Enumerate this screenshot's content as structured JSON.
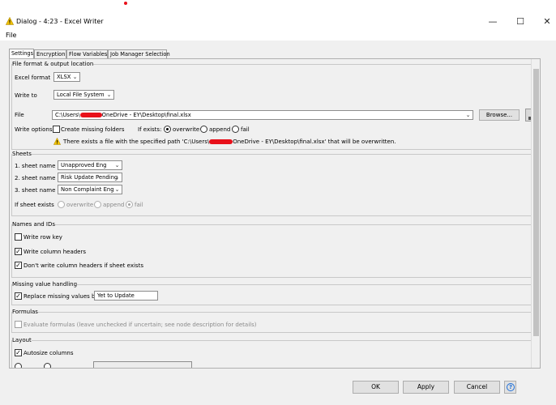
{
  "window": {
    "title": "Dialog - 4:23 - Excel Writer",
    "menu_file": "File",
    "minimize_glyph": "—",
    "maximize_glyph": "☐",
    "close_glyph": "✕"
  },
  "tabs": [
    "Settings",
    "Encryption",
    "Flow Variables",
    "Job Manager Selection"
  ],
  "file_section": {
    "title": "File format & output location",
    "excel_format_label": "Excel format",
    "excel_format_value": "XLSX",
    "write_to_label": "Write to",
    "write_to_value": "Local File System",
    "file_label": "File",
    "file_path_prefix": "C:\\Users\\",
    "file_path_suffix": "OneDrive - EY\\Desktop\\final.xlsx",
    "browse_label": "Browse...",
    "write_options_label": "Write options",
    "create_missing_label": "Create missing folders",
    "if_exists_label": "If exists:",
    "opt_overwrite": "overwrite",
    "opt_append": "append",
    "opt_fail": "fail",
    "warning_prefix": "There exists a file with the specified path 'C:\\Users\\",
    "warning_suffix": "OneDrive - EY\\Desktop\\final.xlsx' that will be overwritten."
  },
  "sheets_section": {
    "title": "Sheets",
    "sheet_labels": [
      "1. sheet name",
      "2. sheet name",
      "3. sheet name"
    ],
    "sheet_values": [
      "Unapproved Eng",
      "Risk Update Pending",
      "Non Complaint Eng"
    ],
    "if_sheet_exists_label": "If sheet exists",
    "opt_overwrite": "overwrite",
    "opt_append": "append",
    "opt_fail": "fail"
  },
  "names_section": {
    "title": "Names and IDs",
    "write_row_key": "Write row key",
    "write_column_headers": "Write column headers",
    "dont_write_headers": "Don't write column headers if sheet exists"
  },
  "missing_section": {
    "title": "Missing value handling",
    "replace_label": "Replace missing values by",
    "replace_value": "Yet to Update"
  },
  "formulas_section": {
    "title": "Formulas",
    "evaluate_label": "Evaluate formulas (leave unchecked if uncertain; see node description for details)"
  },
  "layout_section": {
    "title": "Layout",
    "autosize_label": "Autosize columns"
  },
  "footer": {
    "ok": "OK",
    "apply": "Apply",
    "cancel": "Cancel",
    "help_glyph": "?"
  },
  "colors": {
    "redaction": "#e8101a",
    "warning": "#f2c200",
    "help": "#1e6fd9"
  }
}
